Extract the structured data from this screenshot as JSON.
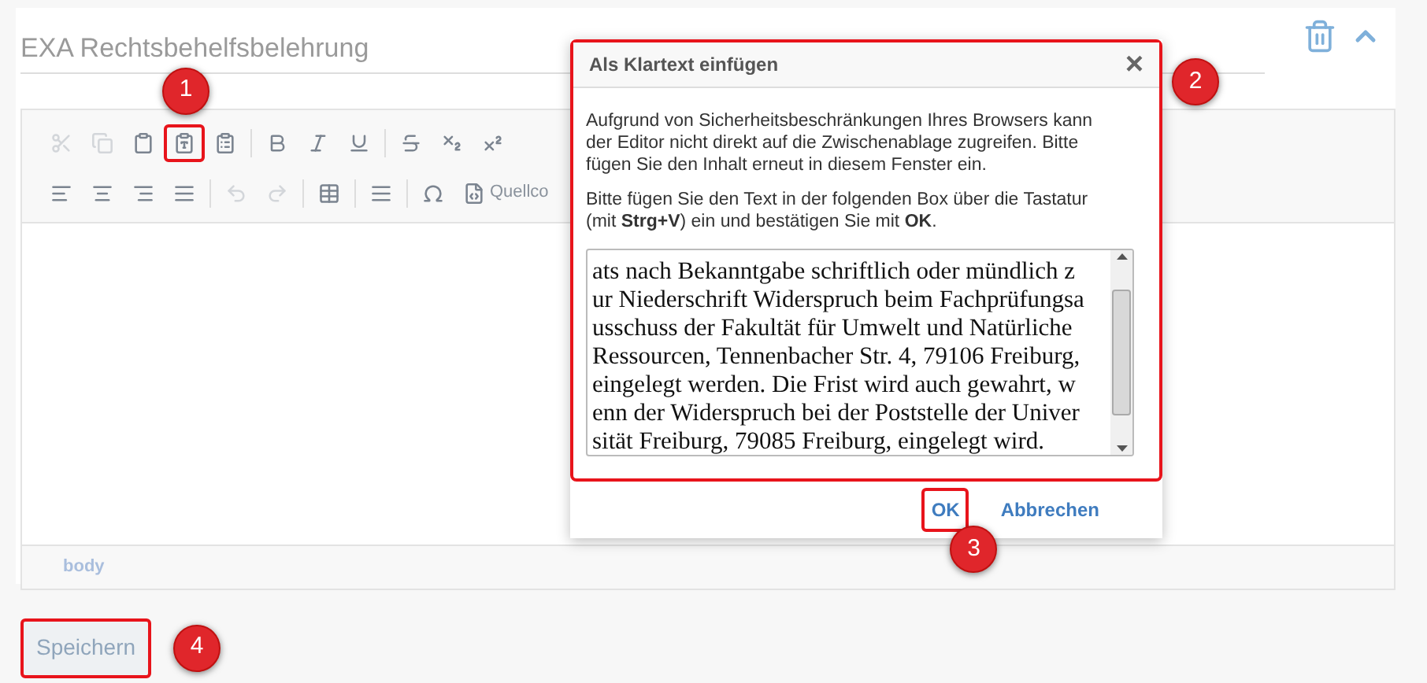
{
  "title": "EXA Rechtsbehelfsbelehrung",
  "toolbar_rows": [
    [
      {
        "kind": "cut",
        "disabled": true
      },
      {
        "kind": "copy",
        "disabled": true
      },
      {
        "kind": "paste",
        "disabled": false
      },
      {
        "kind": "paste_text",
        "disabled": false,
        "annotation": "1"
      },
      {
        "kind": "paste_word",
        "disabled": false
      },
      {
        "kind": "sep"
      },
      {
        "kind": "bold",
        "disabled": false
      },
      {
        "kind": "italic",
        "disabled": false
      },
      {
        "kind": "underline",
        "disabled": false
      },
      {
        "kind": "sep"
      },
      {
        "kind": "strike",
        "disabled": false
      },
      {
        "kind": "sub",
        "disabled": false
      },
      {
        "kind": "sup",
        "disabled": false
      }
    ],
    [
      {
        "kind": "align_left",
        "disabled": false
      },
      {
        "kind": "align_center",
        "disabled": false
      },
      {
        "kind": "align_right",
        "disabled": false
      },
      {
        "kind": "justify",
        "disabled": false
      },
      {
        "kind": "sep"
      },
      {
        "kind": "undo",
        "disabled": true
      },
      {
        "kind": "redo",
        "disabled": true
      },
      {
        "kind": "sep"
      },
      {
        "kind": "table",
        "disabled": false
      },
      {
        "kind": "sep"
      },
      {
        "kind": "hr",
        "disabled": false
      },
      {
        "kind": "sep"
      },
      {
        "kind": "omega",
        "disabled": false
      },
      {
        "kind": "source",
        "disabled": false,
        "label": "Quellco"
      }
    ]
  ],
  "path": "body",
  "dialog": {
    "title": "Als Klartext einfügen",
    "close": "×",
    "annotation": "2",
    "paragraphs": [
      "Aufgrund von Sicherheitsbeschränkungen Ihres Browsers kann der Editor nicht direkt auf die Zwischenablage zugreifen. Bitte fügen Sie den Inhalt erneut in diesem Fenster ein.",
      "Bitte fügen Sie den Text in der folgenden Box über die Tastatur (mit **Strg+V**) ein und bestätigen Sie mit **OK**."
    ],
    "textarea_lines": [
      "ats nach Bekanntgabe schriftlich oder mündlich z",
      "ur Niederschrift Widerspruch beim Fachprüfungsa",
      "usschuss der Fakultät für Umwelt und Natürliche",
      "Ressourcen, Tennenbacher Str. 4, 79106 Freiburg,",
      "eingelegt werden. Die Frist wird auch gewahrt, w",
      "enn der Widerspruch bei der Poststelle der Univer",
      "sität Freiburg, 79085 Freiburg, eingelegt wird."
    ],
    "ok": {
      "label": "OK",
      "annotation": "3"
    },
    "cancel": "Abbrechen"
  },
  "save": {
    "label": "Speichern",
    "annotation": "4"
  }
}
